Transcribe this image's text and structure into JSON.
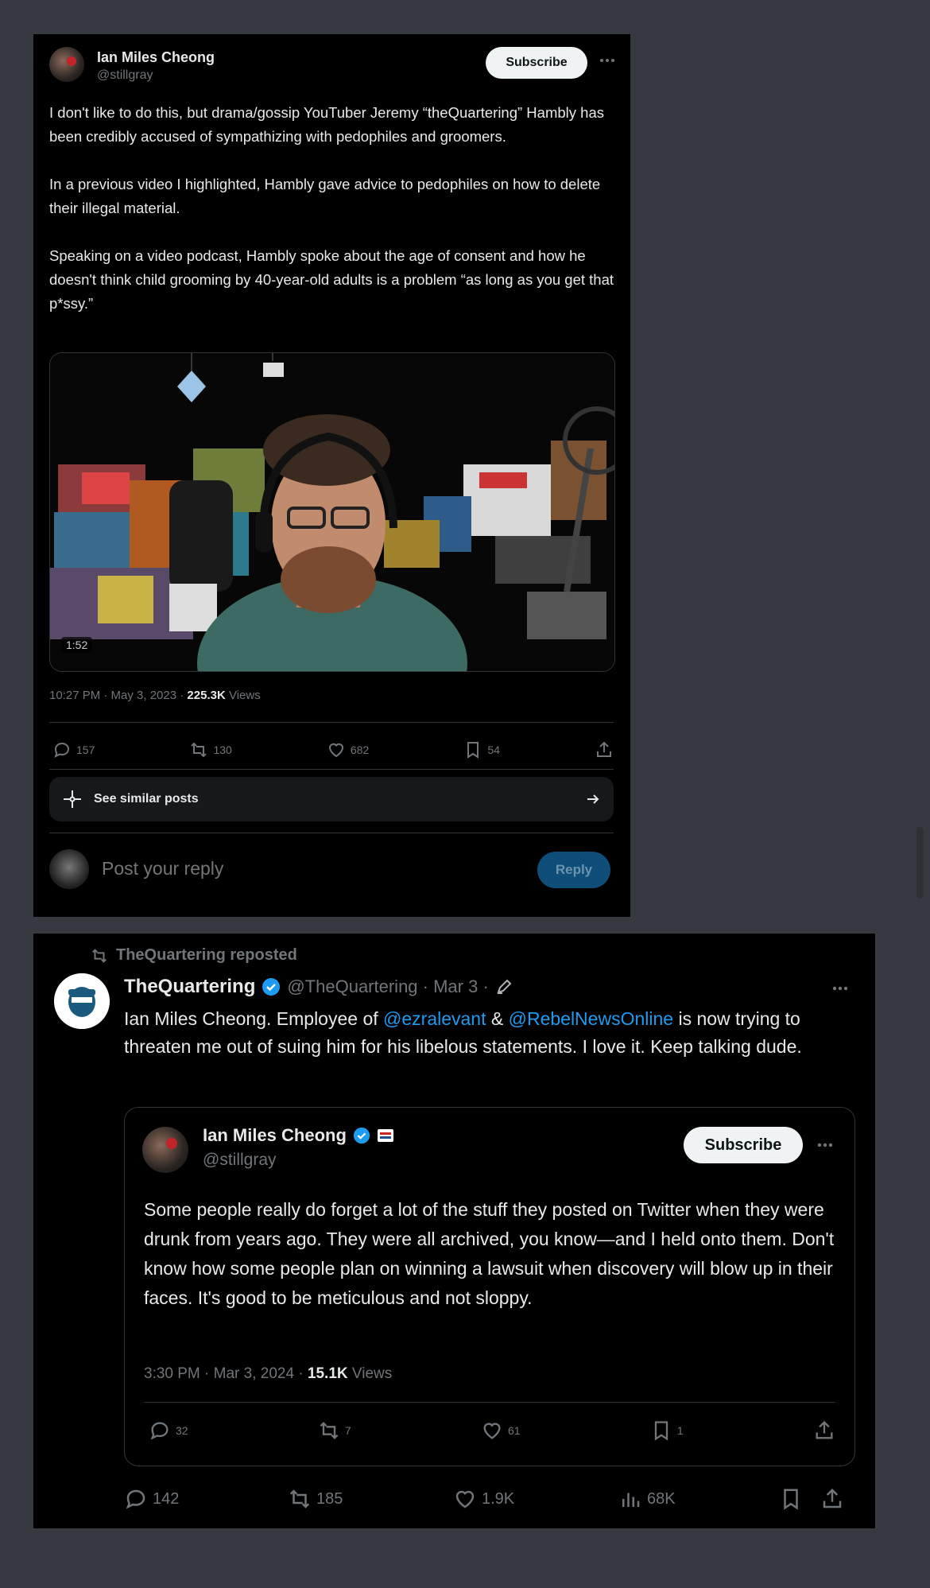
{
  "post1": {
    "author_name": "Ian Miles Cheong",
    "author_handle": "@stillgray",
    "subscribe_label": "Subscribe",
    "body": [
      "I don't like to do this, but drama/gossip YouTuber Jeremy “theQuartering” Hambly has been credibly accused of sympathizing with pedophiles and groomers.",
      "In a previous video I highlighted, Hambly gave advice to pedophiles on how to delete their illegal material.",
      "Speaking on a video podcast, Hambly spoke about the age of consent and how he doesn't think child grooming by 40-year-old adults is a problem “as long as you get that p*ssy.”"
    ],
    "video_duration": "1:52",
    "timestamp": "10:27 PM · May 3, 2023 · ",
    "views_count": "225.3K",
    "views_label": " Views",
    "stats": {
      "replies": "157",
      "reposts": "130",
      "likes": "682",
      "bookmarks": "54"
    },
    "similar_posts_label": "See similar posts",
    "reply_placeholder": "Post your reply",
    "reply_button": "Reply"
  },
  "post2": {
    "repost_label": "TheQuartering reposted",
    "author_name": "TheQuartering",
    "author_meta": "@TheQuartering · Mar 3 ·",
    "body_1": "Ian Miles Cheong.  Employee of ",
    "mention_1": "@ezralevant",
    "body_2": " & ",
    "mention_2": "@RebelNewsOnline",
    "body_3": " is now trying to threaten me out of suing him for his libelous statements.  I love it.  Keep talking dude.",
    "quote": {
      "author_name": "Ian Miles Cheong",
      "author_handle": "@stillgray",
      "subscribe_label": "Subscribe",
      "body": "Some people really do forget a lot of the stuff they posted on Twitter when they were drunk from years ago. They were all archived, you know—and I held onto them. Don't know how some people plan on winning a lawsuit when discovery will blow up in their faces. It's good to be meticulous and not sloppy.",
      "timestamp": "3:30 PM · Mar 3, 2024 · ",
      "views_count": "15.1K",
      "views_label": " Views",
      "stats": {
        "replies": "32",
        "reposts": "7",
        "likes": "61",
        "bookmarks": "1"
      }
    },
    "stats": {
      "replies": "142",
      "reposts": "185",
      "likes": "1.9K",
      "views": "68K"
    }
  },
  "colors": {
    "accent": "#1d9bf0",
    "background": "#36393f",
    "card": "#000000",
    "muted": "#71767b"
  }
}
